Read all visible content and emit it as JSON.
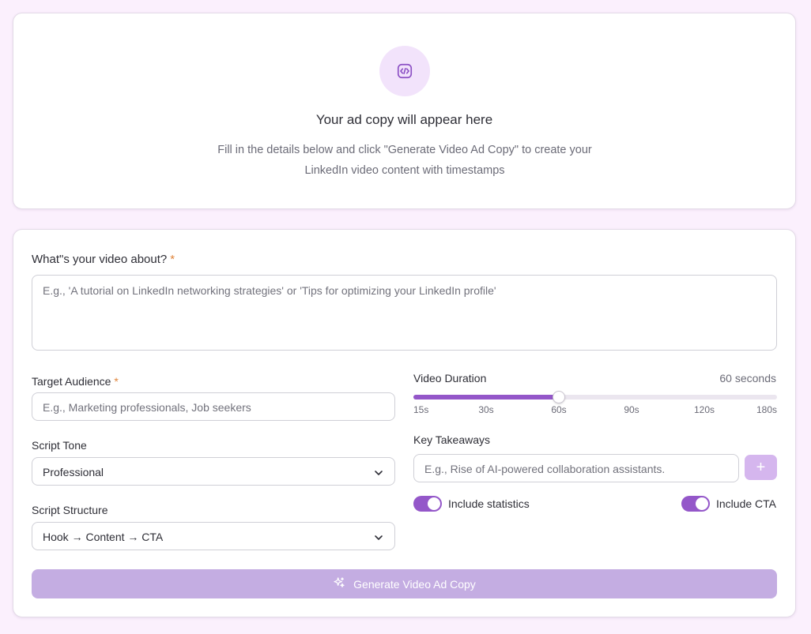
{
  "empty_state": {
    "icon": "code-brackets-icon",
    "title": "Your ad copy will appear here",
    "description": "Fill in the details below and click \"Generate Video Ad Copy\" to create your LinkedIn video content with timestamps"
  },
  "form": {
    "topic": {
      "label": "What\"s your video about?",
      "required_mark": "*",
      "placeholder": "E.g., 'A tutorial on LinkedIn networking strategies' or 'Tips for optimizing your LinkedIn profile'"
    },
    "audience": {
      "label": "Target Audience",
      "required_mark": "*",
      "placeholder": "E.g., Marketing professionals, Job seekers"
    },
    "tone": {
      "label": "Script Tone",
      "selected": "Professional"
    },
    "structure": {
      "label": "Script Structure",
      "selected": "Hook → Content → CTA"
    },
    "duration": {
      "label": "Video Duration",
      "value_text": "60 seconds",
      "value": 60,
      "min": 15,
      "max": 180,
      "ticks": [
        "15s",
        "30s",
        "60s",
        "90s",
        "120s",
        "180s"
      ]
    },
    "takeaways": {
      "label": "Key Takeaways",
      "placeholder": "E.g., Rise of AI-powered collaboration assistants.",
      "add_button": "+"
    },
    "toggles": {
      "statistics": {
        "label": "Include statistics",
        "on": true
      },
      "cta": {
        "label": "Include CTA",
        "on": true
      }
    },
    "generate_button": {
      "label": "Generate Video Ad Copy",
      "icon": "sparkles-icon"
    }
  },
  "colors": {
    "background": "#fbf0fd",
    "accent": "#9457c9",
    "button_disabled": "#c4ade2",
    "required": "#e0853c"
  }
}
